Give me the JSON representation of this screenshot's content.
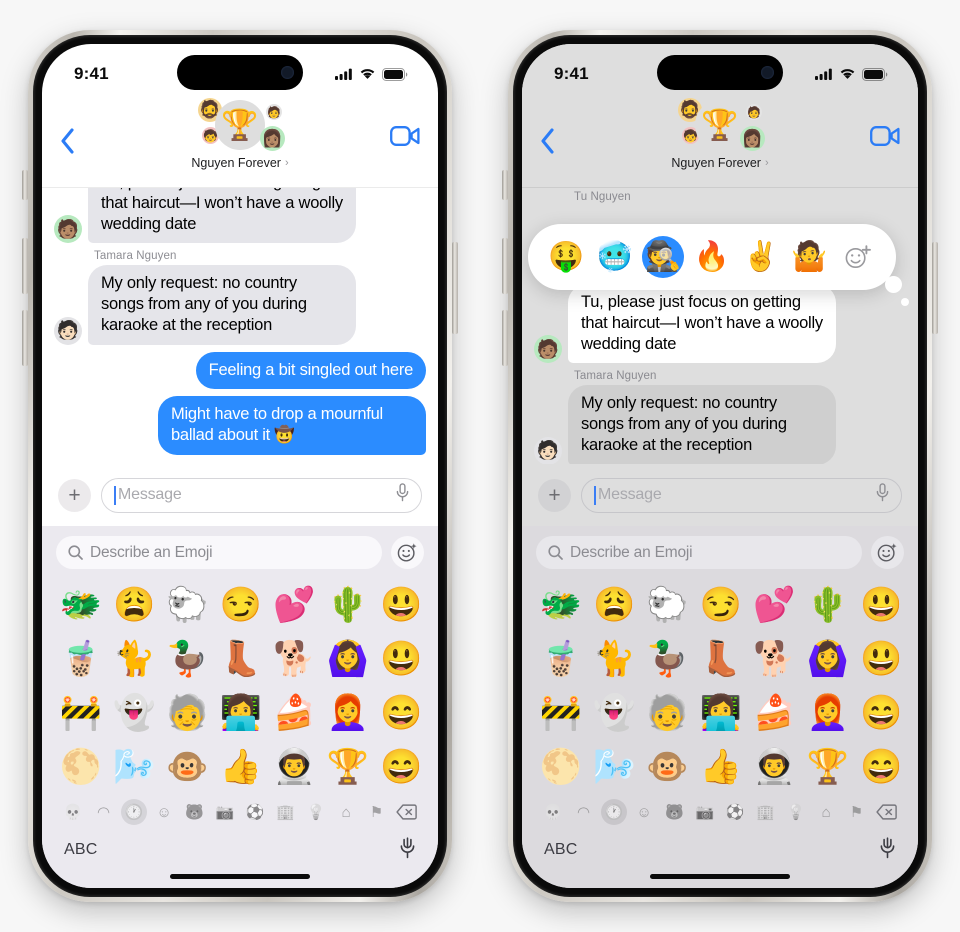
{
  "status_bar": {
    "time": "9:41",
    "cellular": "cellular-bars",
    "wifi": "wifi",
    "battery": "battery-full"
  },
  "nav": {
    "back": "‹",
    "group_name": "Nguyen Forever",
    "chevron": "›",
    "group_avatar_main": "🏆",
    "group_avatar_a": "🧔",
    "group_avatar_b": "🧒",
    "group_avatar_c": "🧑",
    "group_avatar_d": "👩🏽",
    "facetime": "facetime-video-icon"
  },
  "thread_left": {
    "messages": [
      {
        "id": "m1",
        "side": "in",
        "sender": "",
        "avatar": "🧑🏽",
        "text": "Tu, please just focus on getting that haircut—I won’t have a woolly wedding date",
        "clipped": true
      },
      {
        "id": "m2",
        "side": "in",
        "sender": "Tamara Nguyen",
        "avatar": "🧑🏻",
        "text": "My only request: no country songs from any of you during karaoke at the reception",
        "clipped": false
      },
      {
        "id": "m3",
        "side": "out",
        "sender": "",
        "avatar": "",
        "text": "Feeling a bit singled out here",
        "clipped": false
      },
      {
        "id": "m4",
        "side": "out",
        "sender": "",
        "avatar": "",
        "text": "Might have to drop a mournful ballad about it 🤠",
        "clipped": false
      }
    ]
  },
  "thread_right": {
    "top_sender": "Tu Nguyen",
    "messages": [
      {
        "id": "r1",
        "side": "in",
        "sender": "",
        "avatar": "🧑🏽",
        "text": "Tu, please just focus on getting that haircut—I won’t have a woolly wedding date",
        "focused": true
      },
      {
        "id": "r2",
        "side": "in",
        "sender": "Tamara Nguyen",
        "avatar": "🧑🏻",
        "text": "My only request: no country songs from any of you during karaoke at the reception",
        "focused": false
      }
    ]
  },
  "tapback": {
    "options": [
      "🤑",
      "🥶",
      "🕵️",
      "🔥",
      "✌️",
      "🤷"
    ],
    "selected_index": 2,
    "add_label": "add-emoji",
    "selected_color": "#2b8cff"
  },
  "compose": {
    "plus": "+",
    "placeholder": "Message",
    "value": "",
    "mic": "mic-icon"
  },
  "keyboard": {
    "search_placeholder": "Describe an Emoji",
    "search_icon": "search-icon",
    "genmoji_icon": "genmoji-sparkle-icon",
    "emoji_rows": [
      [
        "🐲",
        "😩",
        "🐑",
        "😏",
        "💕",
        "🌵",
        "😃"
      ],
      [
        "🧋",
        "🐈",
        "🦆",
        "👢",
        "🐕",
        "🙆‍♀️",
        "😃"
      ],
      [
        "🚧",
        "👻",
        "🧓",
        "👩‍💻",
        "🍰",
        "👩‍🦰",
        "😄"
      ],
      [
        "🌕",
        "🌬️",
        "🐵",
        "👍",
        "👨‍🚀",
        "🏆",
        "😄"
      ]
    ],
    "categories": [
      {
        "name": "recents-frequently-used",
        "glyph": "💀",
        "active": false
      },
      {
        "name": "stickers",
        "glyph": "◠",
        "active": false
      },
      {
        "name": "clock-recents",
        "glyph": "🕐",
        "active": true
      },
      {
        "name": "smileys-and-people",
        "glyph": "☺",
        "active": false
      },
      {
        "name": "animals-and-nature",
        "glyph": "🐻",
        "active": false
      },
      {
        "name": "food-and-drink",
        "glyph": "📷",
        "active": false
      },
      {
        "name": "activity",
        "glyph": "⚽",
        "active": false
      },
      {
        "name": "travel-and-places",
        "glyph": "🏢",
        "active": false
      },
      {
        "name": "objects",
        "glyph": "💡",
        "active": false
      },
      {
        "name": "symbols",
        "glyph": "⌂",
        "active": false
      },
      {
        "name": "flags",
        "glyph": "⚑",
        "active": false
      }
    ],
    "delete_key": "delete-backspace",
    "abc_key": "ABC",
    "dictation_key": "dictation-mic-icon"
  },
  "colors": {
    "page_background": "#f7f7f7",
    "bubble_incoming": "#e5e5ea",
    "bubble_outgoing": "#2b8cff",
    "accent_blue": "#2b8cff",
    "keyboard_background": "#ebe9ef",
    "dimmed_overlay": "#dedede"
  }
}
